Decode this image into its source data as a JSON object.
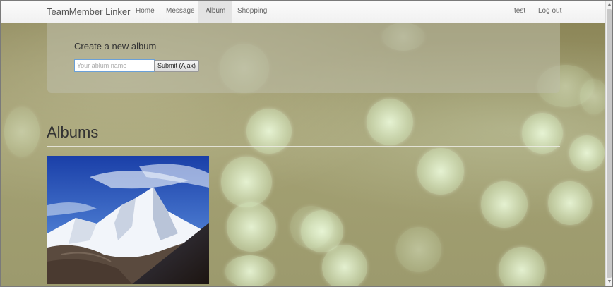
{
  "navbar": {
    "brand": "TeamMember Linker",
    "links": [
      {
        "label": "Home"
      },
      {
        "label": "Message"
      },
      {
        "label": "Album"
      },
      {
        "label": "Shopping"
      }
    ],
    "active": "Album",
    "right_links": [
      {
        "label": "test"
      },
      {
        "label": "Log out"
      }
    ]
  },
  "create_album": {
    "title": "Create a new album",
    "input_placeholder": "Your ablum name",
    "input_value": "",
    "submit_label": "Submit (Ajax)"
  },
  "albums": {
    "title": "Albums",
    "items": [
      {
        "thumbnail": "snowy-mountain-image"
      }
    ]
  },
  "colors": {
    "navbar_bg": "#f8f8f8",
    "active_nav_bg": "#e3e3e3",
    "input_border": "#6aa0d8"
  }
}
